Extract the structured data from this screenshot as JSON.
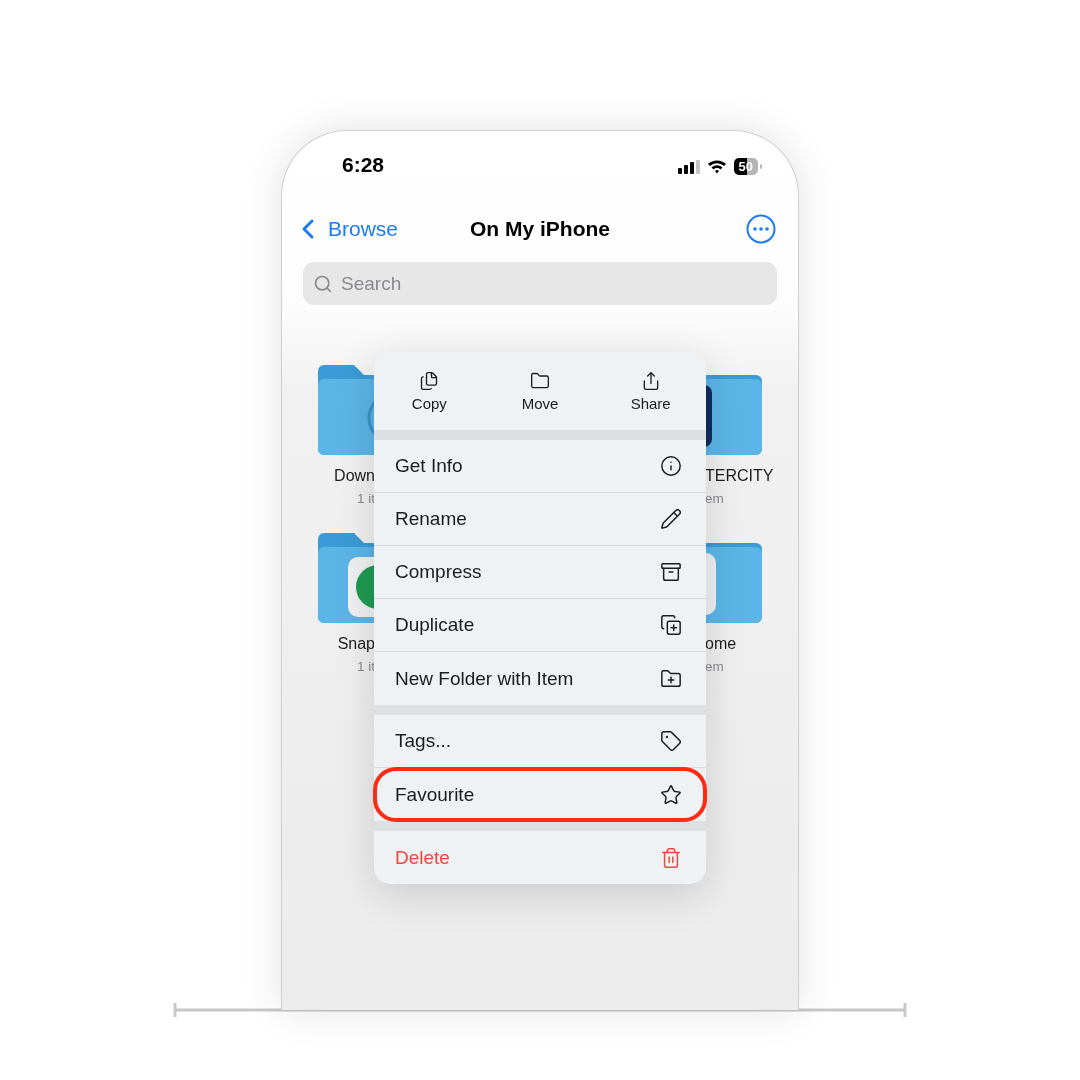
{
  "status_bar": {
    "time": "6:28",
    "battery": "50"
  },
  "nav": {
    "back": "Browse",
    "title": "On My iPhone"
  },
  "search": {
    "placeholder": "Search"
  },
  "folder_rows": [
    {
      "left": {
        "label": "Down",
        "count": "1 it"
      },
      "right": {
        "label": "TERCITY",
        "count": "em"
      }
    },
    {
      "left": {
        "label": "Snap",
        "count": "1 it"
      },
      "right": {
        "label": "ome",
        "count": "em"
      }
    }
  ],
  "menu": {
    "actions": [
      {
        "label": "Copy"
      },
      {
        "label": "Move"
      },
      {
        "label": "Share"
      }
    ],
    "sections": [
      {
        "items": [
          {
            "label": "Get Info",
            "highlighted": false,
            "destructive": false
          },
          {
            "label": "Rename",
            "highlighted": false,
            "destructive": false
          },
          {
            "label": "Compress",
            "highlighted": false,
            "destructive": false
          },
          {
            "label": "Duplicate",
            "highlighted": false,
            "destructive": false
          },
          {
            "label": "New Folder with Item",
            "highlighted": false,
            "destructive": false
          }
        ]
      },
      {
        "items": [
          {
            "label": "Tags...",
            "highlighted": false,
            "destructive": false
          },
          {
            "label": "Favourite",
            "highlighted": true,
            "destructive": false
          }
        ]
      },
      {
        "items": [
          {
            "label": "Delete",
            "highlighted": false,
            "destructive": true
          }
        ]
      }
    ]
  }
}
